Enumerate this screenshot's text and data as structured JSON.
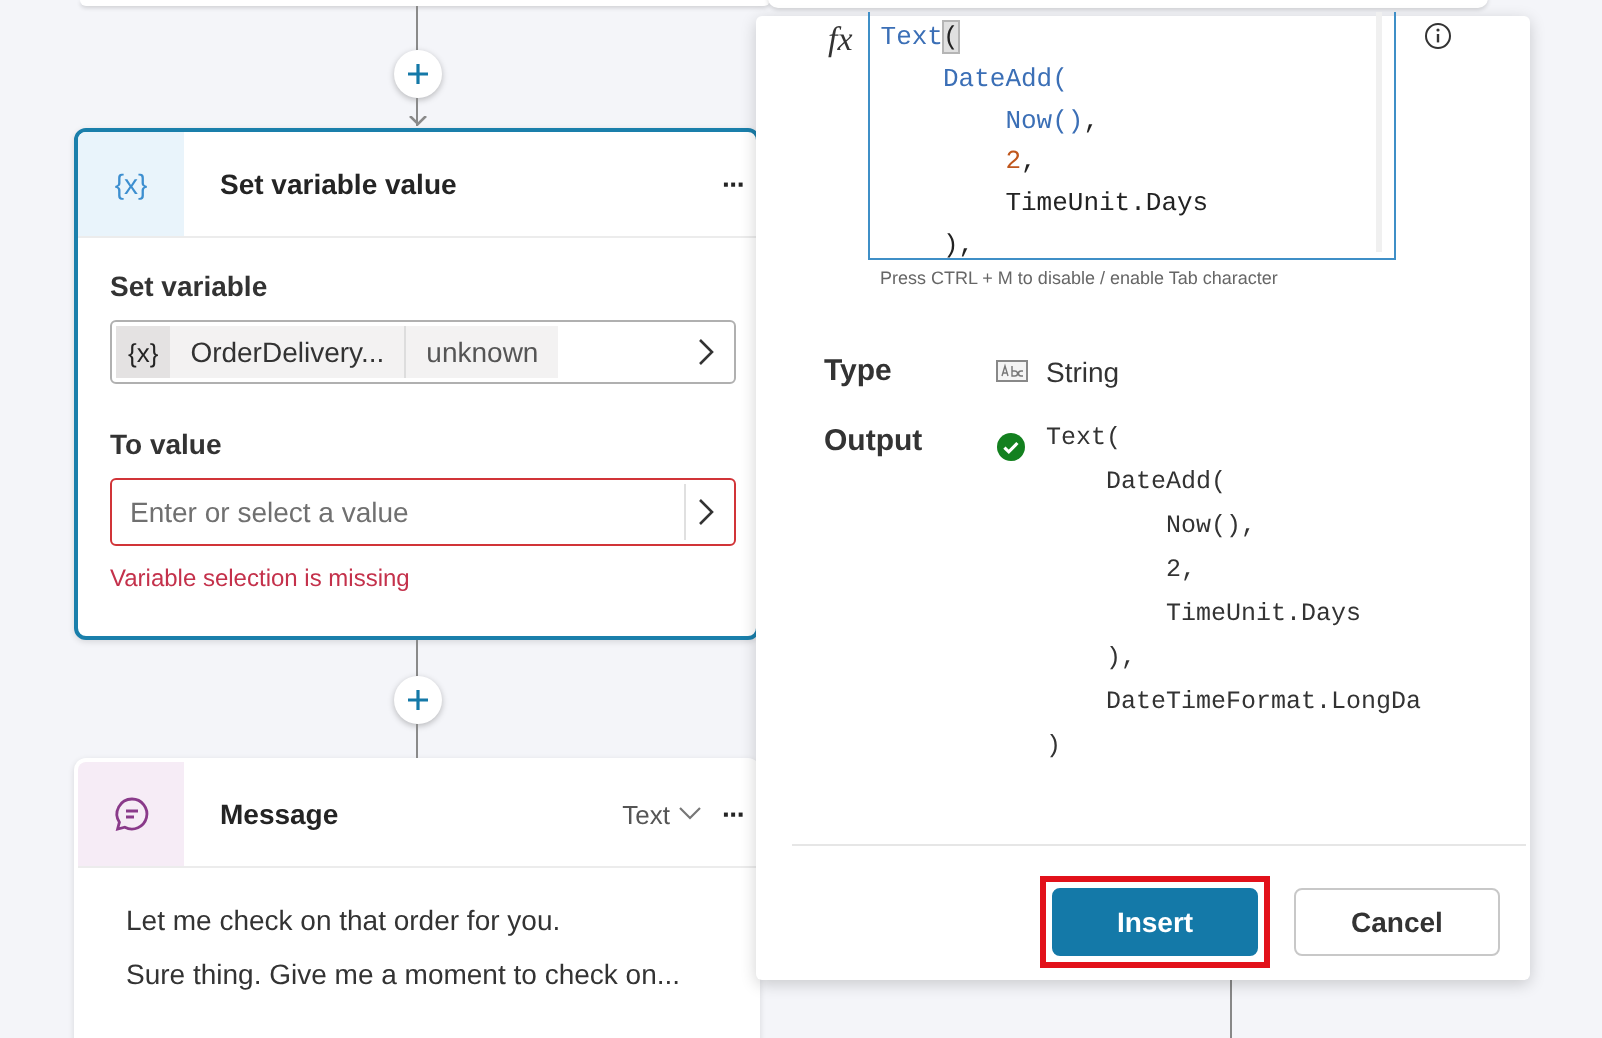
{
  "set_variable_card": {
    "title": "Set variable value",
    "icon": "{x}",
    "more": "···",
    "selected": true,
    "set_variable": {
      "label": "Set variable",
      "chip_icon": "{x}",
      "variable": "OrderDelivery...",
      "type": "unknown"
    },
    "to_value": {
      "label": "To value",
      "placeholder": "Enter or select a value",
      "error": "Variable selection is missing"
    }
  },
  "message_card": {
    "title": "Message",
    "format": "Text",
    "more": "···",
    "lines": [
      "Let me check on that order for you.",
      "Sure thing. Give me a moment to check on..."
    ]
  },
  "formula_panel": {
    "fx": "fx",
    "editor_lines": [
      [
        {
          "text": "Text",
          "kind": "fn"
        },
        {
          "text": "(",
          "kind": "match"
        }
      ],
      [
        {
          "text": "    DateAdd(",
          "kind": "fn"
        }
      ],
      [
        {
          "text": "        Now()",
          "kind": "fn"
        },
        {
          "text": ",",
          "kind": "plain"
        }
      ],
      [
        {
          "text": "        2",
          "kind": "num"
        },
        {
          "text": ",",
          "kind": "plain"
        }
      ],
      [
        {
          "text": "        TimeUnit.Days",
          "kind": "plain"
        }
      ],
      [
        {
          "text": "    ),",
          "kind": "plain"
        }
      ]
    ],
    "hint": "Press CTRL + M to disable / enable Tab character",
    "type_label": "Type",
    "type_value": "String",
    "output_label": "Output",
    "output_valid": true,
    "output_lines": [
      "Text(",
      "    DateAdd(",
      "        Now(),",
      "        2,",
      "        TimeUnit.Days",
      "    ),",
      "    DateTimeFormat.LongDa",
      ")"
    ],
    "buttons": [
      {
        "label": "Insert",
        "primary": true,
        "highlighted": true
      },
      {
        "label": "Cancel",
        "primary": false,
        "highlighted": false
      }
    ]
  }
}
